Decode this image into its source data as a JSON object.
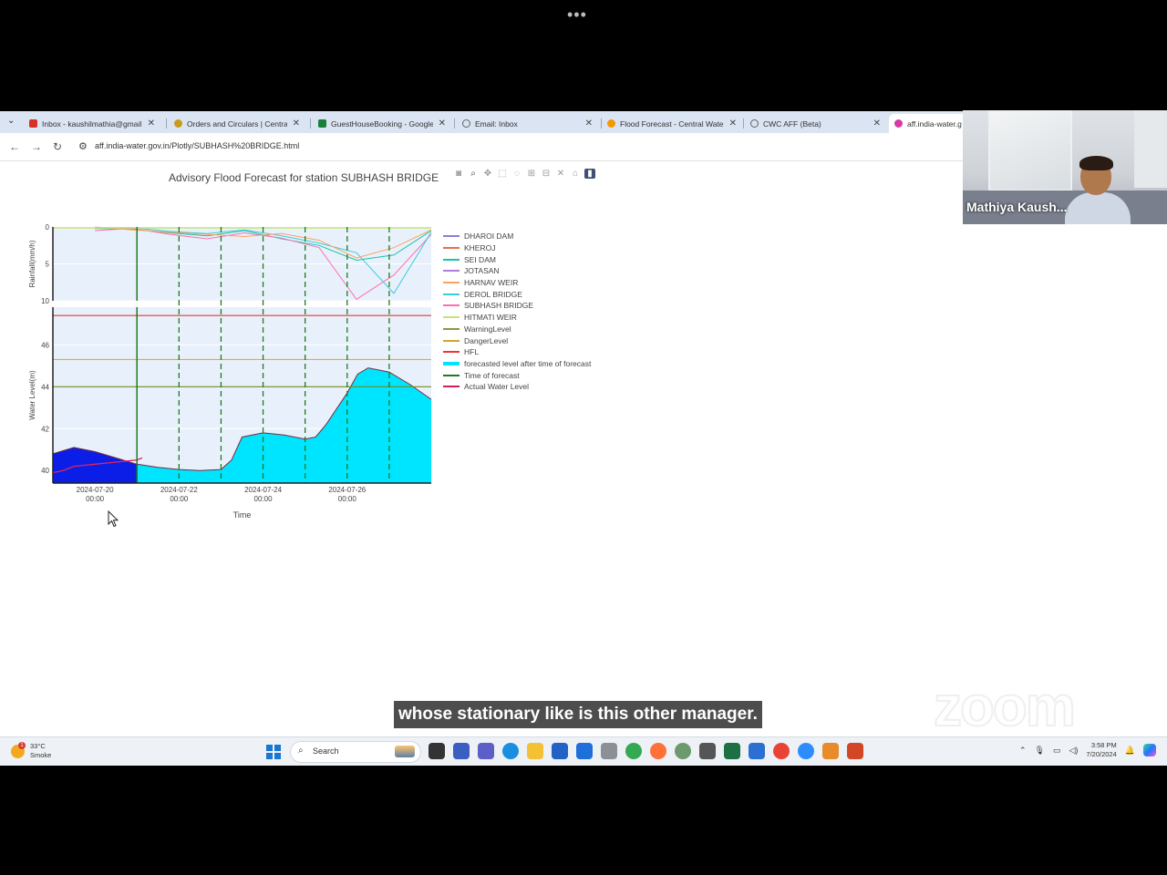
{
  "window": {
    "dots": "•••"
  },
  "browser": {
    "tabs": [
      {
        "title": "Inbox - kaushilmathia@gmail.c",
        "icon": "gmail-icon",
        "color": "#d93025"
      },
      {
        "title": "Orders and Circulars | Central V",
        "icon": "emblem-icon",
        "color": "#c99a1c"
      },
      {
        "title": "GuestHouseBooking - Google",
        "icon": "sheets-icon",
        "color": "#188038"
      },
      {
        "title": "Email: Inbox",
        "icon": "globe-icon",
        "color": "#5f6368"
      },
      {
        "title": "Flood Forecast - Central Water",
        "icon": "cwc-icon",
        "color": "#f29900"
      },
      {
        "title": "CWC AFF (Beta)",
        "icon": "globe-icon",
        "color": "#5f6368"
      },
      {
        "title": "aff.india-water.g",
        "icon": "plotly-icon",
        "color": "#d63aa7"
      }
    ],
    "url": "aff.india-water.gov.in/Plotly/SUBHASH%20BRIDGE.html"
  },
  "chart": {
    "title": "Advisory Flood Forecast for station SUBHASH BRIDGE",
    "xlabel": "Time",
    "ylabel_top": "Rainfall(mm/h)",
    "ylabel_bottom": "Water Level(m)",
    "yticks_top": [
      "0",
      "5",
      "10"
    ],
    "yticks_bottom": [
      "40",
      "42",
      "44",
      "46"
    ],
    "xticks": [
      {
        "date": "2024-07-20",
        "time": "00:00"
      },
      {
        "date": "2024-07-22",
        "time": "00:00"
      },
      {
        "date": "2024-07-24",
        "time": "00:00"
      },
      {
        "date": "2024-07-26",
        "time": "00:00"
      }
    ],
    "legend": [
      {
        "label": "DHAROI DAM",
        "color": "#8c7fd6"
      },
      {
        "label": "KHEROJ",
        "color": "#ef6c4e"
      },
      {
        "label": "SEI DAM",
        "color": "#19c4a4"
      },
      {
        "label": "JOTASAN",
        "color": "#b07ce0"
      },
      {
        "label": "HARNAV WEIR",
        "color": "#ffa15a"
      },
      {
        "label": "DEROL BRIDGE",
        "color": "#3ccbe0"
      },
      {
        "label": "SUBHASH BRIDGE",
        "color": "#ff6eb0"
      },
      {
        "label": "HITMATI WEIR",
        "color": "#c6e37a"
      },
      {
        "label": "WarningLevel",
        "color": "#8a9a3a"
      },
      {
        "label": "DangerLevel",
        "color": "#d8a22a"
      },
      {
        "label": "HFL",
        "color": "#e53935"
      },
      {
        "label": "forecasted level after time of forecast",
        "color": "#00e5ff",
        "fill": true
      },
      {
        "label": "Time of forecast",
        "color": "#1e7b1e"
      },
      {
        "label": "Actual Water Level",
        "color": "#d81b60"
      }
    ]
  },
  "chart_data": {
    "type": "line",
    "title": "Advisory Flood Forecast for station SUBHASH BRIDGE",
    "xlabel": "Time",
    "ylabel": "Water Level(m)",
    "ylim": [
      39.4,
      47.8
    ],
    "xlim": [
      "2024-07-19 00:00",
      "2024-07-28 00:00"
    ],
    "levels": {
      "WarningLevel": 44.0,
      "DangerLevel": 45.3,
      "HFL": 47.4
    },
    "time_of_forecast": "2024-07-21 00:00",
    "series": [
      {
        "name": "forecasted level after time of forecast",
        "x": [
          "2024-07-19 00:00",
          "2024-07-19 12:00",
          "2024-07-20 00:00",
          "2024-07-20 12:00",
          "2024-07-21 00:00",
          "2024-07-21 12:00",
          "2024-07-22 00:00",
          "2024-07-22 12:00",
          "2024-07-23 00:00",
          "2024-07-23 06:00",
          "2024-07-23 12:00",
          "2024-07-24 00:00",
          "2024-07-24 12:00",
          "2024-07-25 00:00",
          "2024-07-25 06:00",
          "2024-07-25 12:00",
          "2024-07-26 00:00",
          "2024-07-26 06:00",
          "2024-07-26 12:00",
          "2024-07-27 00:00",
          "2024-07-27 12:00",
          "2024-07-28 00:00"
        ],
        "values": [
          40.8,
          41.1,
          40.9,
          40.6,
          40.3,
          40.15,
          40.05,
          40.0,
          40.05,
          40.5,
          41.6,
          41.8,
          41.7,
          41.5,
          41.6,
          42.2,
          43.7,
          44.6,
          44.9,
          44.7,
          44.1,
          43.4
        ]
      },
      {
        "name": "Actual Water Level",
        "x": [
          "2024-07-19 00:00",
          "2024-07-19 06:00",
          "2024-07-19 12:00",
          "2024-07-20 00:00",
          "2024-07-20 12:00",
          "2024-07-21 00:00",
          "2024-07-21 03:00"
        ],
        "values": [
          39.9,
          40.0,
          40.2,
          40.3,
          40.4,
          40.5,
          40.6
        ]
      }
    ],
    "rainfall_ylim": [
      10,
      0
    ],
    "rainfall_series": [
      {
        "name": "SEI DAM",
        "x": [
          0,
          1,
          2,
          3,
          4,
          5,
          6,
          7,
          8,
          9
        ],
        "values": [
          0.2,
          0.3,
          0.8,
          1.2,
          0.5,
          1.6,
          2.5,
          4.5,
          3.8,
          0.5
        ]
      },
      {
        "name": "SUBHASH BRIDGE",
        "x": [
          0,
          1,
          2,
          3,
          4,
          5,
          6,
          7,
          8,
          9
        ],
        "values": [
          0.5,
          0.2,
          1.0,
          1.6,
          0.8,
          1.5,
          2.8,
          9.8,
          6.5,
          1.0
        ]
      },
      {
        "name": "DEROL BRIDGE",
        "x": [
          0,
          1,
          2,
          3,
          4,
          5,
          6,
          7,
          8,
          9
        ],
        "values": [
          0.1,
          0.1,
          0.6,
          0.9,
          0.4,
          1.2,
          2.2,
          3.5,
          9.0,
          0.7
        ]
      },
      {
        "name": "HARNAV WEIR",
        "x": [
          0,
          1,
          2,
          3,
          4,
          5,
          6,
          7,
          8,
          9
        ],
        "values": [
          0.0,
          0.4,
          0.7,
          1.0,
          1.3,
          0.9,
          1.8,
          4.2,
          2.8,
          0.4
        ]
      }
    ]
  },
  "meeting": {
    "participant_name": "Mathiya Kaush...",
    "caption": "whose stationary like is this other manager.",
    "logo": "zoom"
  },
  "taskbar": {
    "weather_temp": "33°C",
    "weather_desc": "Smoke",
    "weather_badge": "1",
    "search_placeholder": "Search",
    "time": "3:58 PM",
    "date": "7/20/2024"
  }
}
